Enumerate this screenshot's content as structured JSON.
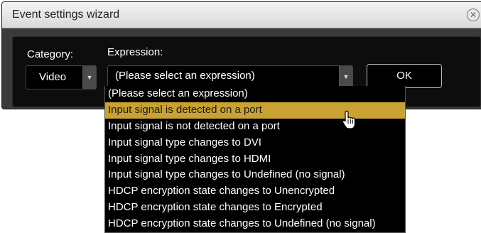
{
  "dialog": {
    "title": "Event settings wizard"
  },
  "category": {
    "label": "Category:",
    "value": "Video"
  },
  "expression": {
    "label": "Expression:",
    "value": "(Please select an expression)"
  },
  "ok_button": {
    "label": "OK"
  },
  "dropdown": {
    "options": [
      "(Please select an expression)",
      "Input signal is detected on a port",
      "Input signal is not detected on a port",
      "Input signal type changes to DVI",
      "Input signal type changes to HDMI",
      "Input signal type changes to Undefined (no signal)",
      "HDCP encryption state changes to Unencrypted",
      "HDCP encryption state changes to Encrypted",
      "HDCP encryption state changes to Undefined (no signal)"
    ],
    "highlighted_index": 1
  },
  "colors": {
    "highlight": "#c8a233",
    "panel": "#0d0d0d"
  },
  "icons": {
    "close": "close-icon",
    "arrow": "chevron-down-icon",
    "cursor": "hand-pointer-icon"
  }
}
